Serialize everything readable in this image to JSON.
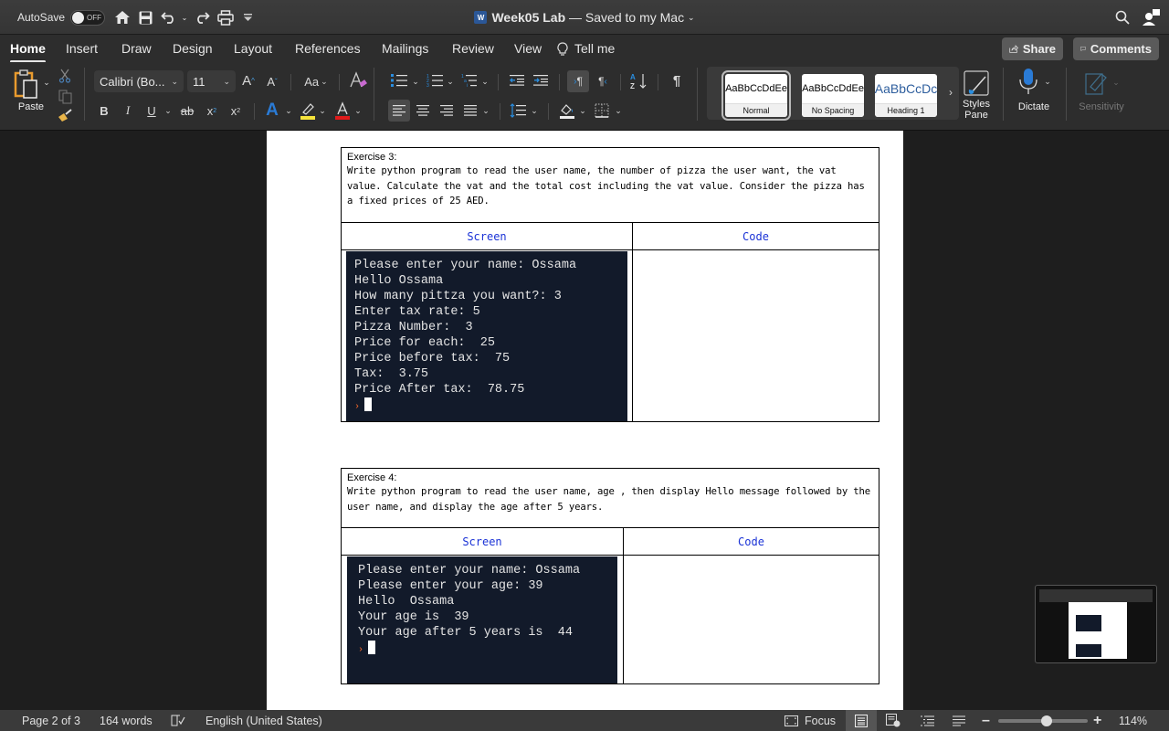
{
  "titlebar": {
    "autosave_label": "AutoSave",
    "autosave_state": "OFF",
    "doc_name": "Week05 Lab",
    "doc_status": "— Saved to my Mac",
    "icons": [
      "home-icon",
      "save-icon",
      "undo-icon",
      "redo-icon",
      "print-icon",
      "customize-icon",
      "search-icon",
      "account-icon"
    ]
  },
  "tabs": [
    {
      "label": "Home",
      "active": true
    },
    {
      "label": "Insert"
    },
    {
      "label": "Draw"
    },
    {
      "label": "Design"
    },
    {
      "label": "Layout"
    },
    {
      "label": "References"
    },
    {
      "label": "Mailings"
    },
    {
      "label": "Review"
    },
    {
      "label": "View"
    },
    {
      "label": "Tell me"
    }
  ],
  "header_buttons": {
    "share": "Share",
    "comments": "Comments"
  },
  "ribbon": {
    "paste_label": "Paste",
    "font_name": "Calibri (Bo...",
    "font_size": "11",
    "change_case": "Aa",
    "bold": "B",
    "italic": "I",
    "underline": "U",
    "strike": "ab",
    "subscript": "x",
    "superscript": "x",
    "highlight_color": "#f5e33b",
    "font_color": "#e01b1b",
    "styles": [
      {
        "preview": "AaBbCcDdEe",
        "label": "Normal",
        "selected": true
      },
      {
        "preview": "AaBbCcDdEe",
        "label": "No Spacing"
      },
      {
        "preview": "AaBbCcDc",
        "label": "Heading 1"
      }
    ],
    "styles_pane": "Styles Pane",
    "dictate": "Dictate",
    "sensitivity": "Sensitivity"
  },
  "document": {
    "exercise3": {
      "title": "Exercise 3:",
      "text": "Write python program to read the user name, the number of pizza the user want, the vat value. Calculate the vat and the total cost including the vat value. Consider the pizza has a fixed prices of 25 AED.",
      "col_screen": "Screen",
      "col_code": "Code",
      "terminal": "Please enter your name: Ossama\nHello Ossama\nHow many pittza you want?: 3\nEnter tax rate: 5\nPizza Number:  3\nPrice for each:  25\nPrice before tax:  75\nTax:  3.75\nPrice After tax:  78.75",
      "prompt": "›"
    },
    "exercise4": {
      "title": "Exercise 4:",
      "text": "Write python program to read the user name, age , then display Hello message followed by the user name, and display the age after 5 years.",
      "col_screen": "Screen",
      "col_code": "Code",
      "terminal": "Please enter your name: Ossama\nPlease enter your age: 39\nHello  Ossama\nYour age is  39\nYour age after 5 years is  44",
      "prompt": "›"
    }
  },
  "statusbar": {
    "page": "Page 2 of 3",
    "words": "164 words",
    "language": "English (United States)",
    "focus": "Focus",
    "zoom": "114%",
    "zoom_percent": 114
  }
}
